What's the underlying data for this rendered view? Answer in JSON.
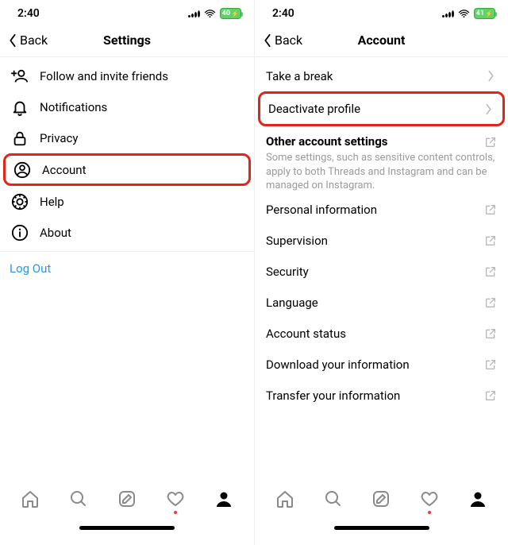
{
  "status": {
    "time": "2:40",
    "battery_left": "40",
    "battery_right": "41"
  },
  "left": {
    "back": "Back",
    "title": "Settings",
    "rows": {
      "follow": "Follow and invite friends",
      "notifications": "Notifications",
      "privacy": "Privacy",
      "account": "Account",
      "help": "Help",
      "about": "About"
    },
    "logout": "Log Out"
  },
  "right": {
    "back": "Back",
    "title": "Account",
    "rows": {
      "take_break": "Take a break",
      "deactivate": "Deactivate profile"
    },
    "section": {
      "title": "Other account settings",
      "desc": "Some settings, such as sensitive content controls, apply to both Threads and Instagram and can be managed on Instagram."
    },
    "ext_rows": {
      "personal": "Personal information",
      "supervision": "Supervision",
      "security": "Security",
      "language": "Language",
      "status": "Account status",
      "download": "Download your information",
      "transfer": "Transfer your information"
    }
  }
}
